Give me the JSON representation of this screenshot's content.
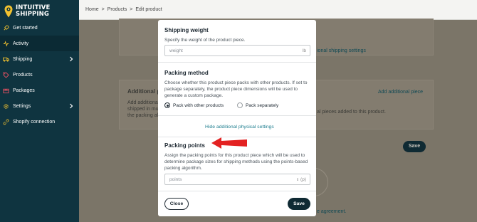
{
  "app": {
    "logo_line1": "INTUITIVE",
    "logo_line2": "SHIPPING"
  },
  "sidebar": {
    "items": [
      {
        "label": "Get started",
        "icon": "rocket-icon"
      },
      {
        "label": "Activity",
        "icon": "activity-icon",
        "active": true
      },
      {
        "label": "Shipping",
        "icon": "truck-icon",
        "has_children": true
      },
      {
        "label": "Products",
        "icon": "tag-icon"
      },
      {
        "label": "Packages",
        "icon": "box-icon"
      },
      {
        "label": "Settings",
        "icon": "gear-icon",
        "has_children": true
      },
      {
        "label": "Shopify connection",
        "icon": "link-icon"
      }
    ]
  },
  "breadcrumb": {
    "home": "Home",
    "products": "Products",
    "current": "Edit product",
    "separator": ">"
  },
  "background": {
    "additional_title": "Additional p",
    "additional_desc_1": "Add additional",
    "additional_desc_2": "shipped in mult",
    "additional_desc_3": "the packing alg",
    "shipping_settings_link": "ional shipping settings",
    "add_additional_link": "Add additional piece",
    "pieces_note": "al pieces added to this product.",
    "save_label": "Save",
    "agreement_text": "e agreement."
  },
  "modal": {
    "shipping_weight": {
      "title": "Shipping weight",
      "desc": "Specify the weight of the product piece.",
      "placeholder": "weight",
      "unit": "lb"
    },
    "packing_method": {
      "title": "Packing method",
      "desc": "Choose whether this product piece packs with other products. If set to package separately, the product piece dimensions will be used to generate a custom package.",
      "options": [
        {
          "label": "Pack with other products",
          "selected": true
        },
        {
          "label": "Pack separately",
          "selected": false
        }
      ]
    },
    "hide_link": "Hide additional physical settings",
    "packing_points": {
      "title": "Packing points",
      "desc": "Assign the packing points for this product piece which will be used to determine package sizes for shipping methods using the points-based packing algorithm.",
      "placeholder": "points",
      "unit": "(p)"
    },
    "close_label": "Close",
    "save_label": "Save"
  },
  "colors": {
    "sidebar_bg": "#0f3440",
    "logo_yellow": "#f2c230",
    "primary_button": "#0f2a33",
    "link": "#1e7e8f",
    "annotation_arrow": "#e32222"
  }
}
